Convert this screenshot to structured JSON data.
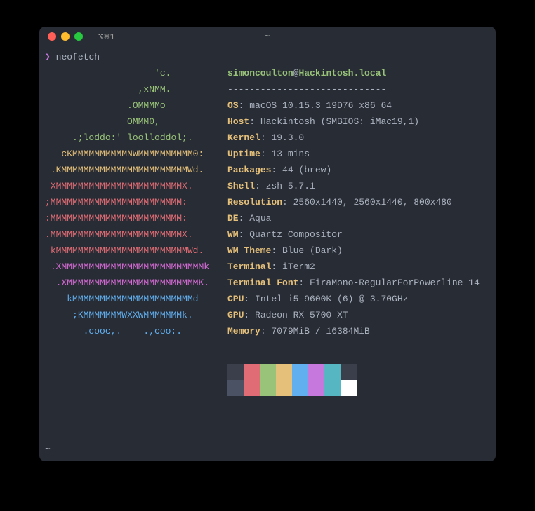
{
  "titlebar": {
    "left_text": "⌥⌘1",
    "center_text": "~"
  },
  "prompt": {
    "symbol": "❯",
    "command": "neofetch"
  },
  "logo_lines": [
    {
      "pad": "                    ",
      "segs": [
        [
          "g",
          "'c."
        ]
      ]
    },
    {
      "pad": "                 ",
      "segs": [
        [
          "g",
          ",xNMM."
        ]
      ]
    },
    {
      "pad": "               ",
      "segs": [
        [
          "g",
          ".OMMMMo"
        ]
      ]
    },
    {
      "pad": "               ",
      "segs": [
        [
          "g",
          "OMMM0,"
        ]
      ]
    },
    {
      "pad": "     ",
      "segs": [
        [
          "g",
          ".;loddo:' loolloddol;."
        ]
      ]
    },
    {
      "pad": "   ",
      "segs": [
        [
          "y",
          "cKMMMMMMMMMMNWMMMMMMMMMM0:"
        ]
      ]
    },
    {
      "pad": " ",
      "segs": [
        [
          "y",
          ".KMMMMMMMMMMMMMMMMMMMMMMMWd."
        ]
      ]
    },
    {
      "pad": " ",
      "segs": [
        [
          "r",
          "XMMMMMMMMMMMMMMMMMMMMMMMX."
        ]
      ]
    },
    {
      "pad": "",
      "segs": [
        [
          "r",
          ";MMMMMMMMMMMMMMMMMMMMMMMM:"
        ]
      ]
    },
    {
      "pad": "",
      "segs": [
        [
          "r",
          ":MMMMMMMMMMMMMMMMMMMMMMMM:"
        ]
      ]
    },
    {
      "pad": "",
      "segs": [
        [
          "r",
          ".MMMMMMMMMMMMMMMMMMMMMMMMX."
        ]
      ]
    },
    {
      "pad": " ",
      "segs": [
        [
          "r",
          "kMMMMMMMMMMMMMMMMMMMMMMMMWd."
        ]
      ]
    },
    {
      "pad": " ",
      "segs": [
        [
          "p",
          ".XMMMMMMMMMMMMMMMMMMMMMMMMMMk"
        ]
      ]
    },
    {
      "pad": "  ",
      "segs": [
        [
          "p",
          ".XMMMMMMMMMMMMMMMMMMMMMMMMK."
        ]
      ]
    },
    {
      "pad": "    ",
      "segs": [
        [
          "b",
          "kMMMMMMMMMMMMMMMMMMMMMMd"
        ]
      ]
    },
    {
      "pad": "     ",
      "segs": [
        [
          "b",
          ";KMMMMMMMWXXWMMMMMMMk."
        ]
      ]
    },
    {
      "pad": "       ",
      "segs": [
        [
          "b",
          ".cooc,.    .,coo:."
        ]
      ]
    }
  ],
  "identity": {
    "user": "simoncoulton",
    "at": "@",
    "host": "Hackintosh.local"
  },
  "divider": "-----------------------------",
  "details": [
    {
      "label": "OS",
      "value": "macOS 10.15.3 19D76 x86_64"
    },
    {
      "label": "Host",
      "value": "Hackintosh (SMBIOS: iMac19,1)"
    },
    {
      "label": "Kernel",
      "value": "19.3.0"
    },
    {
      "label": "Uptime",
      "value": "13 mins"
    },
    {
      "label": "Packages",
      "value": "44 (brew)"
    },
    {
      "label": "Shell",
      "value": "zsh 5.7.1"
    },
    {
      "label": "Resolution",
      "value": "2560x1440, 2560x1440, 800x480"
    },
    {
      "label": "DE",
      "value": "Aqua"
    },
    {
      "label": "WM",
      "value": "Quartz Compositor"
    },
    {
      "label": "WM Theme",
      "value": "Blue (Dark)"
    },
    {
      "label": "Terminal",
      "value": "iTerm2"
    },
    {
      "label": "Terminal Font",
      "value": "FiraMono-RegularForPowerline 14"
    },
    {
      "label": "CPU",
      "value": "Intel i5-9600K (6) @ 3.70GHz"
    },
    {
      "label": "GPU",
      "value": "Radeon RX 5700 XT"
    },
    {
      "label": "Memory",
      "value": "7079MiB / 16384MiB"
    }
  ],
  "swatches_top": [
    "#3a3f4b",
    "#e06c75",
    "#98c379",
    "#e5c07b",
    "#61afef",
    "#c678dd",
    "#56b6c2",
    "#3a3f4b"
  ],
  "swatches_bottom": [
    "#4b5263",
    "#e06c75",
    "#98c379",
    "#e5c07b",
    "#61afef",
    "#c678dd",
    "#56b6c2",
    "#ffffff"
  ],
  "footer": "~"
}
